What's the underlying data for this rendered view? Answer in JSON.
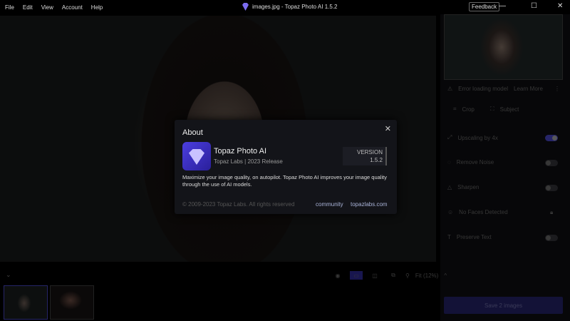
{
  "menu": [
    "File",
    "Edit",
    "View",
    "Account",
    "Help"
  ],
  "window_title": "images.jpg - Topaz Photo AI 1.5.2",
  "feedback": "Feedback",
  "side": {
    "error": "Error loading model",
    "learn_more": "Learn More",
    "crop": "Crop",
    "subject": "Subject",
    "items": [
      {
        "label": "Upscaling by 4x",
        "on": true
      },
      {
        "label": "Remove Noise",
        "on": false
      },
      {
        "label": "Sharpen",
        "on": false
      },
      {
        "label": "No Faces Detected",
        "locked": true
      },
      {
        "label": "Preserve Text",
        "on": false
      }
    ],
    "save": "Save 2 images"
  },
  "toolbar": {
    "zoom": "Fit (12%)"
  },
  "about": {
    "title": "About",
    "product": "Topaz Photo AI",
    "subtitle": "Topaz Labs | 2023 Release",
    "version_label": "VERSION",
    "version": "1.5.2",
    "description": "Maximize your image quality, on autopilot. Topaz Photo AI improves your image quality through the use of AI models.",
    "copyright": "© 2009-2023 Topaz Labs. All rights reserved",
    "link_community": "community",
    "link_site": "topazlabs.com"
  },
  "colors": {
    "accent": "#4b3ee0",
    "save_button": "#1e1d55"
  }
}
